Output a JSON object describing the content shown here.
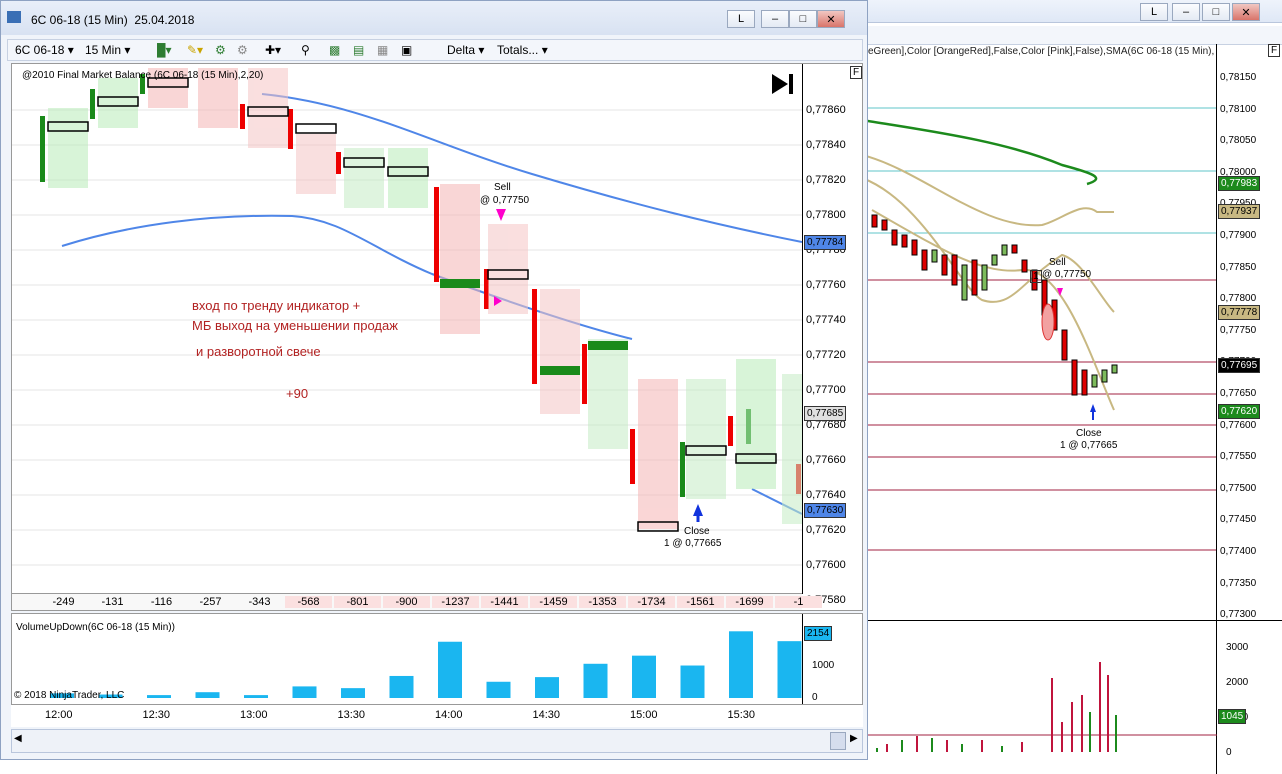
{
  "main_window": {
    "title_symbol": "6C 06-18 (15 Min)",
    "title_date": "25.04.2018",
    "btn_l": "L"
  },
  "toolbar": {
    "instrument": "6C 06-18",
    "interval": "15 Min",
    "delta": "Delta",
    "totals": "Totals..."
  },
  "chart": {
    "indicator_label": "@2010 Final Market Balance  (6C 06-18 (15 Min),2,20)",
    "f_label": "F",
    "price_labels": [
      "0,77860",
      "0,77840",
      "0,77820",
      "0,77800",
      "0,77780",
      "0,77760",
      "0,77740",
      "0,77720",
      "0,77700",
      "0,77680",
      "0,77660",
      "0,77640",
      "0,77620",
      "0,77600",
      "0,77580"
    ],
    "current_price_tag": "0,77784",
    "tag2": "0,77685",
    "tag3": "0,77630",
    "annotation_line1": "вход по тренду   индикатор +",
    "annotation_line2": "МБ выход на уменьшении продаж",
    "annotation_line3": "и разворотной свече",
    "annotation_plus": "+90",
    "sell_label": "Sell",
    "sell_price": "@ 0,77750",
    "close_label": "Close",
    "close_price": "1 @ 0,77665",
    "deltas": [
      "-249",
      "-131",
      "-116",
      "-257",
      "-343",
      "-568",
      "-801",
      "-900",
      "-1237",
      "-1441",
      "-1459",
      "-1353",
      "-1734",
      "-1561",
      "-1699",
      "-1"
    ]
  },
  "volume": {
    "label": "VolumeUpDown(6C 06-18 (15 Min))",
    "copyright": "© 2018 NinjaTrader, LLC",
    "tag": "2154",
    "axis": [
      "1000",
      "0"
    ],
    "bars": [
      0.08,
      0.06,
      0.05,
      0.1,
      0.05,
      0.2,
      0.17,
      0.38,
      0.97,
      0.28,
      0.36,
      0.59,
      0.73,
      0.56,
      1.15,
      0.98
    ]
  },
  "time_axis": [
    "12:00",
    "12:30",
    "13:00",
    "13:30",
    "14:00",
    "14:30",
    "15:00",
    "15:30"
  ],
  "bg_window": {
    "btn_l": "L",
    "indicator_text": "eGreen],Color [OrangeRed],False,Color [Pink],False),SMA(6C 06-18 (15 Min),",
    "f_label": "F",
    "price_labels": [
      "0,78150",
      "0,78100",
      "0,78050",
      "0,78000",
      "0,77950",
      "0,77900",
      "0,77850",
      "0,77800",
      "0,77750",
      "0,77700",
      "0,77650",
      "0,77600",
      "0,77550",
      "0,77500",
      "0,77450",
      "0,77400",
      "0,77350",
      "0,77300"
    ],
    "tag_green": "0,77983",
    "tag_olive1": "0,77937",
    "tag_olive2": "0,77778",
    "tag_black": "0,77695",
    "tag_green2": "0,77620",
    "sell_label": "Sell",
    "sell_qty": "1",
    "sell_price": "@ 0,77750",
    "close_label": "Close",
    "close_price": "1 @ 0,77665",
    "vol_axis": [
      "3000",
      "2000",
      "1000",
      "0"
    ],
    "vol_tag": "1045"
  }
}
